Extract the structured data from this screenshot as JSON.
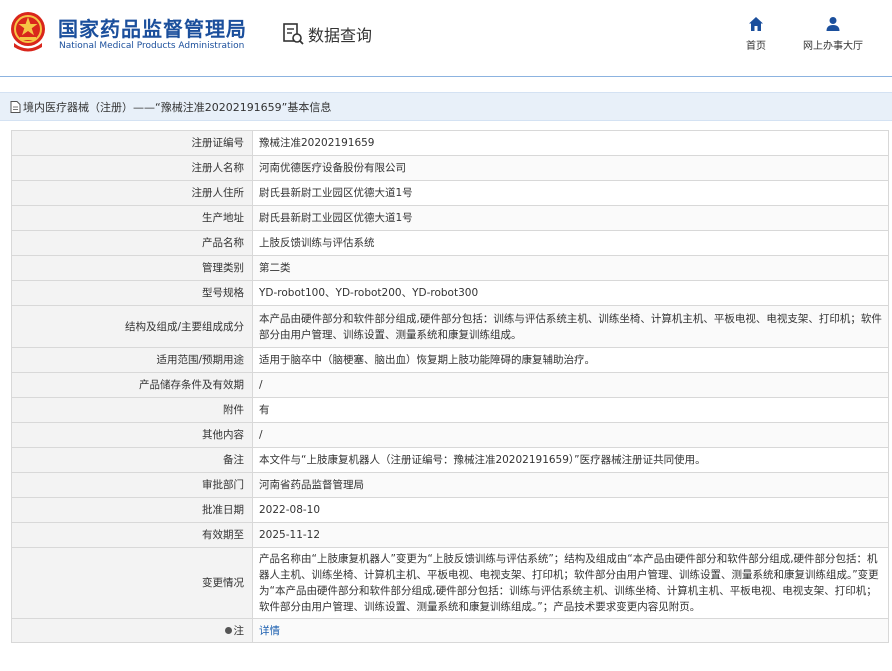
{
  "header": {
    "site_cn": "国家药品监督管理局",
    "site_en": "National Medical Products Administration",
    "query_label": "数据查询",
    "nav": [
      {
        "label": "首页",
        "icon": "home-icon"
      },
      {
        "label": "网上办事大厅",
        "icon": "user-icon"
      }
    ]
  },
  "breadcrumb": {
    "text": "境内医疗器械（注册）——“豫械注准20202191659”基本信息",
    "icon": "document-icon"
  },
  "colors": {
    "brand_blue": "#1b4f9c",
    "link_blue": "#1b5fb0",
    "crumb_bg": "#e8f0f9",
    "label_bg": "#f3f3f3"
  },
  "rows": [
    {
      "label": "注册证编号",
      "value": "豫械注准20202191659"
    },
    {
      "label": "注册人名称",
      "value": "河南优德医疗设备股份有限公司"
    },
    {
      "label": "注册人住所",
      "value": "尉氏县新尉工业园区优德大道1号"
    },
    {
      "label": "生产地址",
      "value": "尉氏县新尉工业园区优德大道1号"
    },
    {
      "label": "产品名称",
      "value": "上肢反馈训练与评估系统"
    },
    {
      "label": "管理类别",
      "value": "第二类"
    },
    {
      "label": "型号规格",
      "value": "YD-robot100、YD-robot200、YD-robot300"
    },
    {
      "label": "结构及组成/主要组成成分",
      "value": "本产品由硬件部分和软件部分组成,硬件部分包括：训练与评估系统主机、训练坐椅、计算机主机、平板电视、电视支架、打印机；软件部分由用户管理、训练设置、测量系统和康复训练组成。"
    },
    {
      "label": "适用范围/预期用途",
      "value": "适用于脑卒中（脑梗塞、脑出血）恢复期上肢功能障碍的康复辅助治疗。"
    },
    {
      "label": "产品储存条件及有效期",
      "value": "/"
    },
    {
      "label": "附件",
      "value": "有"
    },
    {
      "label": "其他内容",
      "value": "/"
    },
    {
      "label": "备注",
      "value": "本文件与“上肢康复机器人（注册证编号：豫械注准20202191659）”医疗器械注册证共同使用。"
    },
    {
      "label": "审批部门",
      "value": "河南省药品监督管理局"
    },
    {
      "label": "批准日期",
      "value": "2022-08-10"
    },
    {
      "label": "有效期至",
      "value": "2025-11-12"
    },
    {
      "label": "变更情况",
      "value": "产品名称由“上肢康复机器人”变更为“上肢反馈训练与评估系统”；结构及组成由“本产品由硬件部分和软件部分组成,硬件部分包括：机器人主机、训练坐椅、计算机主机、平板电视、电视支架、打印机；软件部分由用户管理、训练设置、测量系统和康复训练组成。”变更为“本产品由硬件部分和软件部分组成,硬件部分包括：训练与评估系统主机、训练坐椅、计算机主机、平板电视、电视支架、打印机；软件部分由用户管理、训练设置、测量系统和康复训练组成。”；产品技术要求变更内容见附页。"
    }
  ],
  "note_row": {
    "label": "注",
    "link": "详情",
    "icon": "pin-icon"
  }
}
